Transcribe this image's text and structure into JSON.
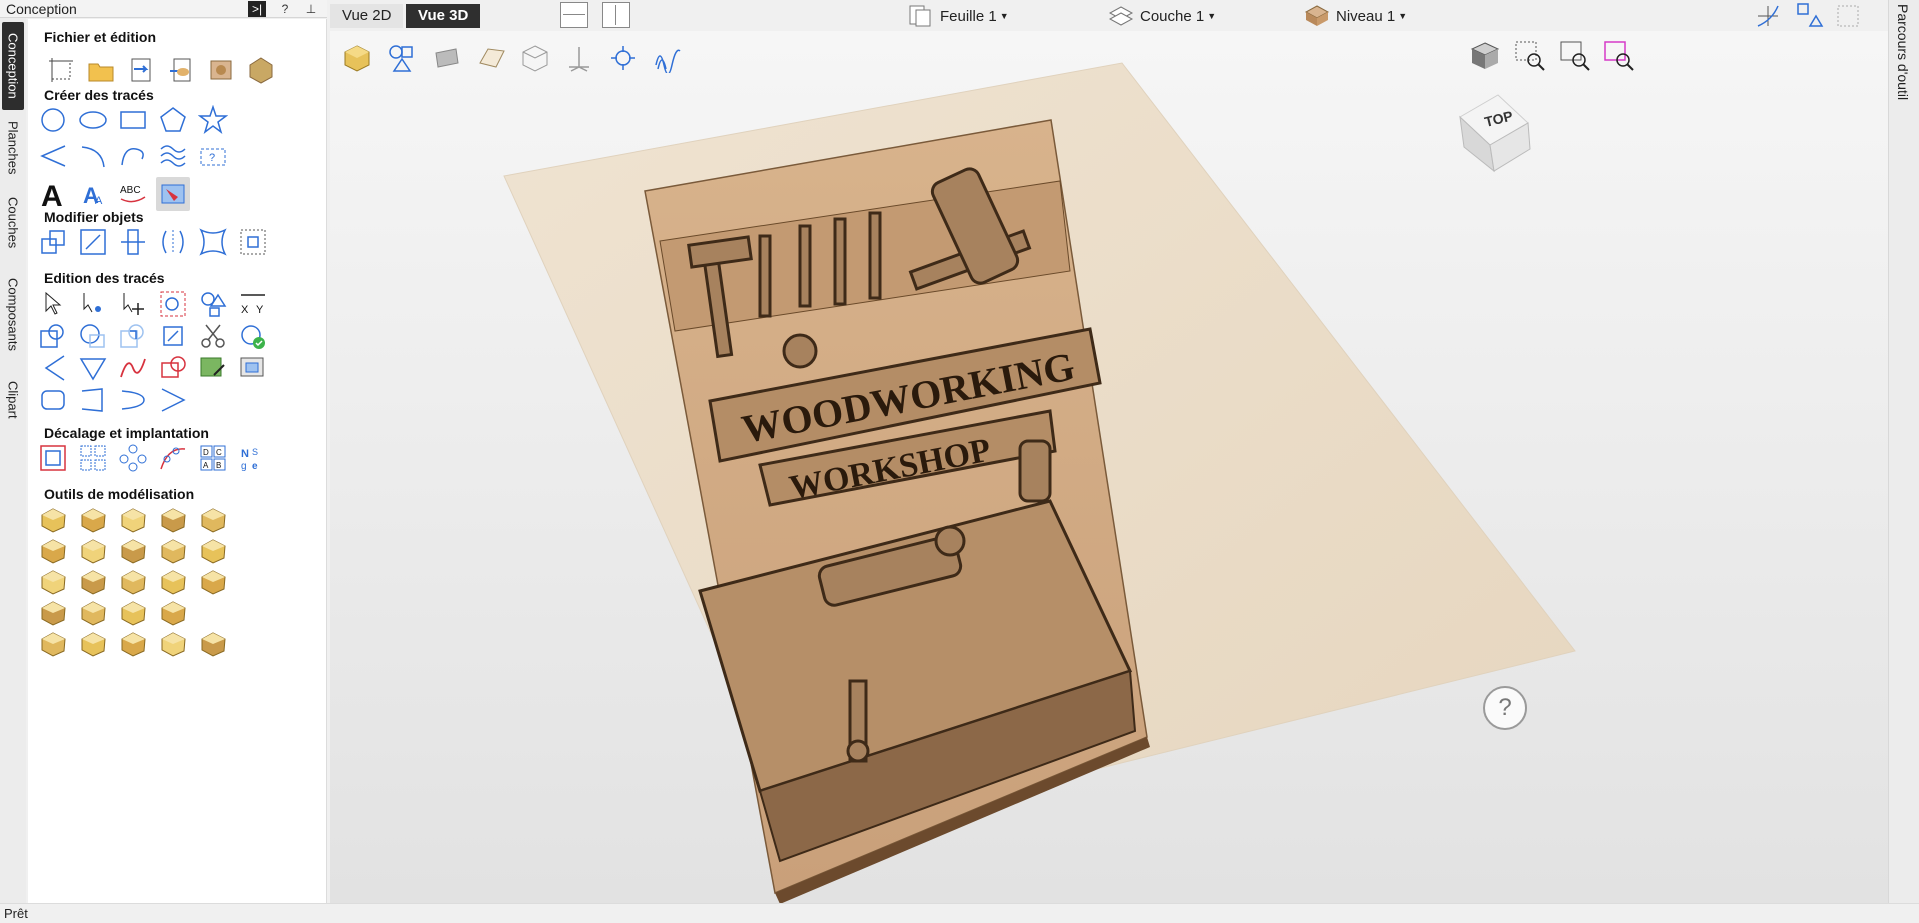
{
  "panel": {
    "title": "Conception",
    "header_buttons": [
      "?",
      "⊥"
    ],
    "vertical_tabs": [
      {
        "label": "Conception",
        "active": true
      },
      {
        "label": "Planches",
        "active": false
      },
      {
        "label": "Couches",
        "active": false
      },
      {
        "label": "Composants",
        "active": false
      },
      {
        "label": "Clipart",
        "active": false
      }
    ],
    "sections": [
      {
        "title": "Fichier et édition"
      },
      {
        "title": "Créer des tracés"
      },
      {
        "title": "Modifier objets"
      },
      {
        "title": "Edition des tracés"
      },
      {
        "title": "Décalage et implantation"
      },
      {
        "title": "Outils de modélisation"
      }
    ]
  },
  "topbar": {
    "view_2d": "Vue 2D",
    "view_3d": "Vue 3D",
    "sheet": "Feuille 1",
    "layer": "Couche 1",
    "level": "Niveau 1"
  },
  "right_strip": {
    "label": "Parcours d'outil"
  },
  "viewport": {
    "view_cube_label": "TOP",
    "help": "?",
    "carving_title_1": "WOODWORKING",
    "carving_title_2": "WORKSHOP"
  },
  "status": {
    "text": "Prêt"
  },
  "colors": {
    "accent_blue": "#2f6fd6",
    "wood_tan": "#d9b48f",
    "active_dark": "#2d2d2d",
    "red_path": "#d7333f"
  }
}
